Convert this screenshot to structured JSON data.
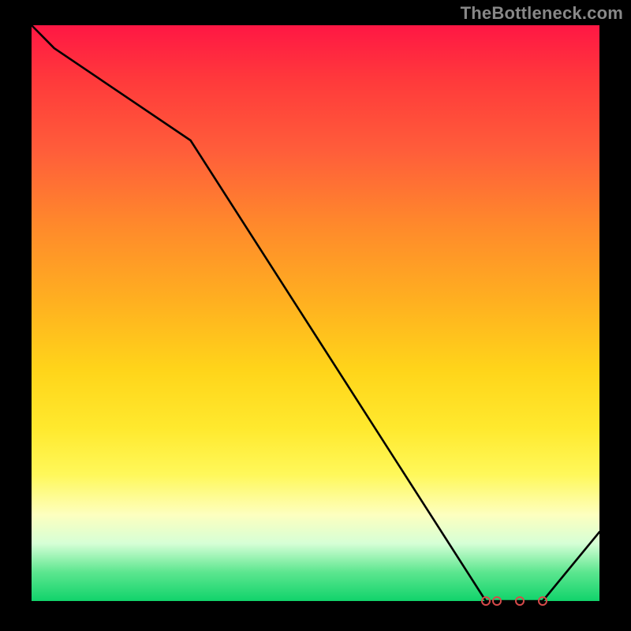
{
  "attribution": "TheBottleneck.com",
  "chart_data": {
    "type": "line",
    "x": [
      0.0,
      0.04,
      0.28,
      0.8,
      0.82,
      0.86,
      0.9,
      1.0
    ],
    "values": [
      1.0,
      0.96,
      0.8,
      0.0,
      0.0,
      0.0,
      0.0,
      0.12
    ],
    "markers": {
      "x": [
        0.8,
        0.82,
        0.86,
        0.9
      ],
      "y": [
        0.0,
        0.0,
        0.0,
        0.0
      ]
    },
    "title": "",
    "xlabel": "",
    "ylabel": "",
    "xlim": [
      0,
      1
    ],
    "ylim": [
      0,
      1
    ],
    "background": "heatmap-gradient",
    "colors": {
      "line": "#000000",
      "marker_stroke": "#d64a4a",
      "top": "#ff1744",
      "bottom": "#11d36b"
    }
  }
}
